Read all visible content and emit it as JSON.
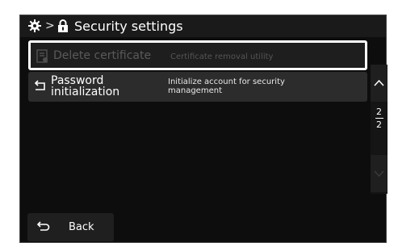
{
  "header": {
    "separator": ">",
    "title": "Security settings"
  },
  "menu": {
    "items": [
      {
        "label": "Delete certificate",
        "description": "Certificate removal utility",
        "state": "selected-disabled"
      },
      {
        "label_line1": "Password",
        "label_line2": "initialization",
        "desc_line1": "Initialize account for security",
        "desc_line2": "management",
        "state": "enabled"
      }
    ]
  },
  "pager": {
    "current": "2",
    "total": "2"
  },
  "footer": {
    "back_label": "Back"
  },
  "colors": {
    "background": "#0d0d0d",
    "selection_border": "#ffffff",
    "text": "#ffffff",
    "disabled_text": "#5a5a5a"
  }
}
